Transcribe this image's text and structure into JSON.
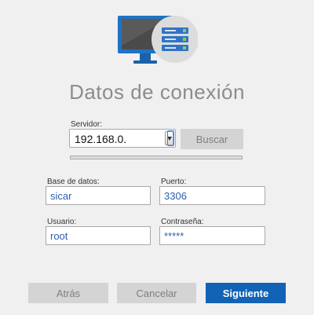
{
  "title": "Datos de conexión",
  "icons": {
    "hero": "server-monitor-icon",
    "dropdown": "chevron-down-icon"
  },
  "server": {
    "label": "Servidor:",
    "value": "192.168.0."
  },
  "search_button": "Buscar",
  "progress": {
    "fraction": 0
  },
  "database": {
    "label": "Base de datos:",
    "value": "sicar"
  },
  "port": {
    "label": "Puerto:",
    "value": "3306"
  },
  "user": {
    "label": "Usuario:",
    "value": "root"
  },
  "password": {
    "label": "Contraseña:",
    "value": "*****"
  },
  "footer": {
    "back": "Atrás",
    "cancel": "Cancelar",
    "next": "Siguiente"
  },
  "colors": {
    "accent": "#1262b5",
    "title": "#8c8c8c",
    "field_text": "#2b5fb2",
    "button_disabled": "#d4d4d4",
    "monitor_blue": "#1f73c4",
    "server_blue": "#2f74c8",
    "led_green": "#8bd13e"
  }
}
